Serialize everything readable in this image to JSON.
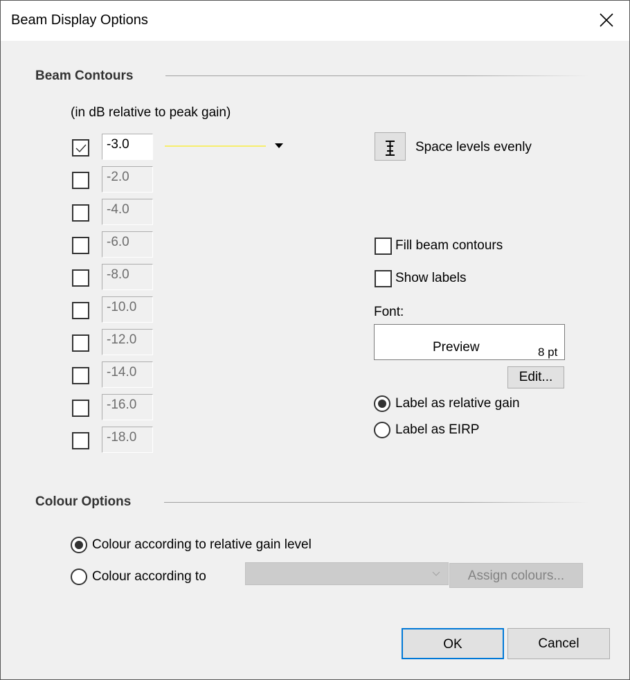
{
  "window": {
    "title": "Beam Display Options",
    "close_icon": "close-icon"
  },
  "beam_contours": {
    "heading": "Beam Contours",
    "units_note": "(in dB relative to peak gain)",
    "levels": [
      {
        "value": "-3.0",
        "checked": true,
        "enabled": true
      },
      {
        "value": "-2.0",
        "checked": false,
        "enabled": false
      },
      {
        "value": "-4.0",
        "checked": false,
        "enabled": false
      },
      {
        "value": "-6.0",
        "checked": false,
        "enabled": false
      },
      {
        "value": "-8.0",
        "checked": false,
        "enabled": false
      },
      {
        "value": "-10.0",
        "checked": false,
        "enabled": false
      },
      {
        "value": "-12.0",
        "checked": false,
        "enabled": false
      },
      {
        "value": "-14.0",
        "checked": false,
        "enabled": false
      },
      {
        "value": "-16.0",
        "checked": false,
        "enabled": false
      },
      {
        "value": "-18.0",
        "checked": false,
        "enabled": false
      }
    ],
    "line_color": "#f7ee6c",
    "space_levels_label": "Space levels evenly",
    "fill_contours": {
      "label": "Fill beam contours",
      "checked": false
    },
    "show_labels": {
      "label": "Show labels",
      "checked": false
    },
    "font_label": "Font:",
    "font_preview": {
      "text": "Preview",
      "size": "8 pt"
    },
    "edit_button": "Edit...",
    "label_mode": {
      "options": [
        {
          "label": "Label as relative gain",
          "selected": true
        },
        {
          "label": "Label as EIRP",
          "selected": false
        }
      ]
    }
  },
  "colour_options": {
    "heading": "Colour Options",
    "options": [
      {
        "label": "Colour according to relative gain level",
        "selected": true
      },
      {
        "label": "Colour according to",
        "selected": false
      }
    ],
    "combo_value": "",
    "assign_button": "Assign colours..."
  },
  "footer": {
    "ok": "OK",
    "cancel": "Cancel",
    "accent": "#0078d7"
  }
}
